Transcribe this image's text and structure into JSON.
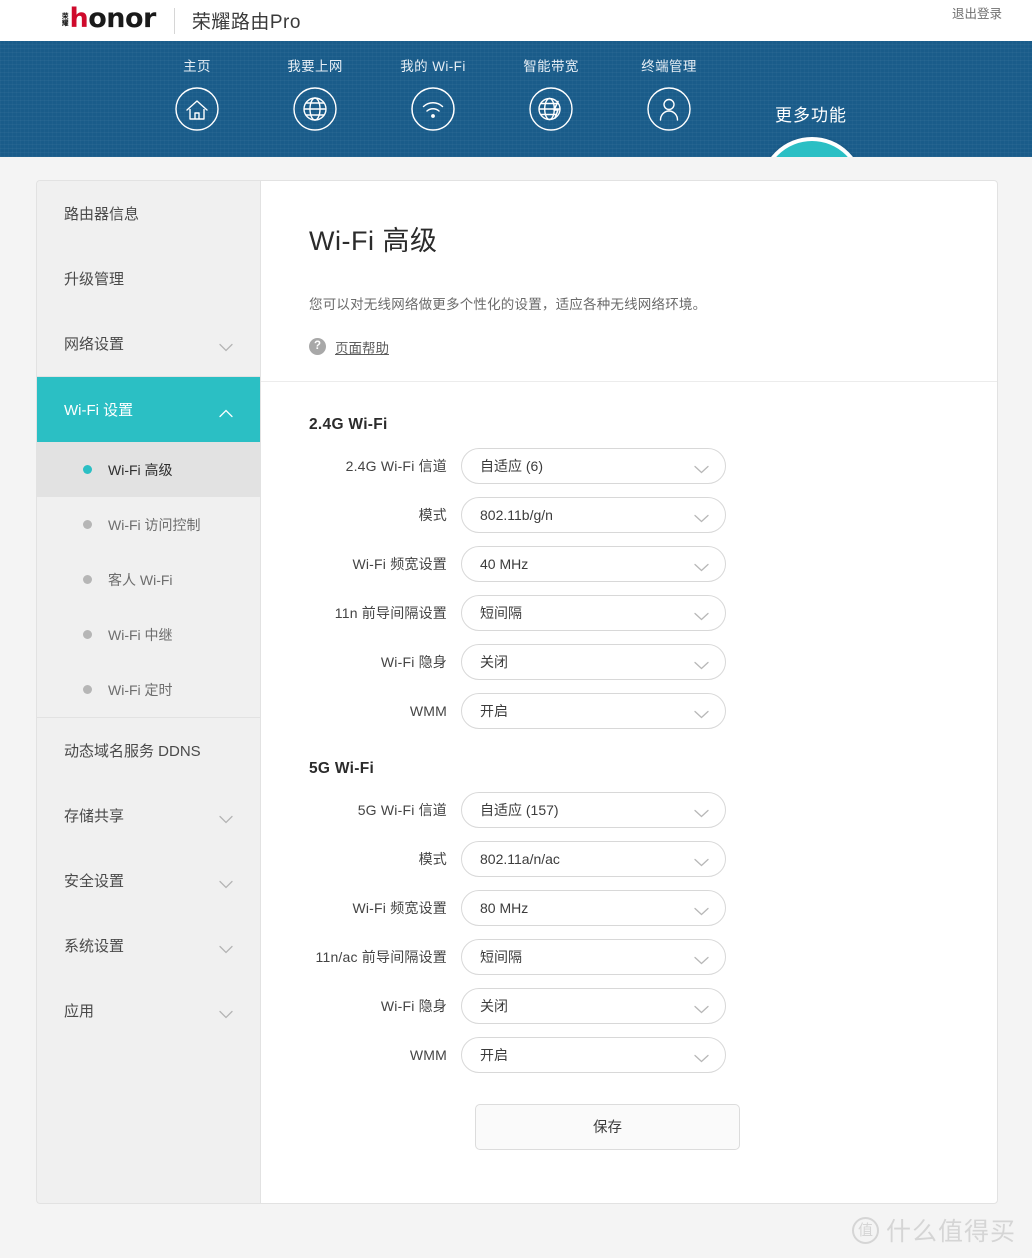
{
  "brand": {
    "logo_cn_top": "荣",
    "logo_cn_bottom": "耀",
    "logo_word_h": "h",
    "logo_word_rest": "onor",
    "product": "荣耀路由Pro",
    "logout": "退出登录"
  },
  "nav": {
    "items": [
      {
        "label": "主页",
        "icon": "home-icon"
      },
      {
        "label": "我要上网",
        "icon": "globe-icon"
      },
      {
        "label": "我的 Wi-Fi",
        "icon": "wifi-icon"
      },
      {
        "label": "智能带宽",
        "icon": "globe-bolt-icon"
      },
      {
        "label": "终端管理",
        "icon": "user-icon"
      }
    ],
    "more_label": "更多功能",
    "more_icon": "hamburger-icon"
  },
  "sidebar": {
    "items": [
      {
        "label": "路由器信息",
        "expandable": false,
        "active": false
      },
      {
        "label": "升级管理",
        "expandable": false,
        "active": false
      },
      {
        "label": "网络设置",
        "expandable": true,
        "active": false
      },
      {
        "label": "Wi-Fi 设置",
        "expandable": true,
        "active": true
      },
      {
        "label": "动态域名服务 DDNS",
        "expandable": false,
        "active": false
      },
      {
        "label": "存储共享",
        "expandable": true,
        "active": false
      },
      {
        "label": "安全设置",
        "expandable": true,
        "active": false
      },
      {
        "label": "系统设置",
        "expandable": true,
        "active": false
      },
      {
        "label": "应用",
        "expandable": true,
        "active": false
      }
    ],
    "sub_items": [
      {
        "label": "Wi-Fi 高级",
        "current": true
      },
      {
        "label": "Wi-Fi 访问控制",
        "current": false
      },
      {
        "label": "客人 Wi-Fi",
        "current": false
      },
      {
        "label": "Wi-Fi 中继",
        "current": false
      },
      {
        "label": "Wi-Fi 定时",
        "current": false
      }
    ]
  },
  "main": {
    "title": "Wi-Fi 高级",
    "description": "您可以对无线网络做更多个性化的设置，适应各种无线网络环境。",
    "help_link": "页面帮助",
    "help_icon_glyph": "?",
    "sections": [
      {
        "title": "2.4G Wi-Fi",
        "fields": [
          {
            "label": "2.4G Wi-Fi 信道",
            "value": "自适应 (6)"
          },
          {
            "label": "模式",
            "value": "802.11b/g/n"
          },
          {
            "label": "Wi-Fi 频宽设置",
            "value": "40 MHz"
          },
          {
            "label": "11n 前导间隔设置",
            "value": "短间隔"
          },
          {
            "label": "Wi-Fi 隐身",
            "value": "关闭"
          },
          {
            "label": "WMM",
            "value": "开启"
          }
        ]
      },
      {
        "title": "5G Wi-Fi",
        "fields": [
          {
            "label": "5G Wi-Fi 信道",
            "value": "自适应 (157)"
          },
          {
            "label": "模式",
            "value": "802.11a/n/ac"
          },
          {
            "label": "Wi-Fi 频宽设置",
            "value": "80 MHz"
          },
          {
            "label": "11n/ac 前导间隔设置",
            "value": "短间隔"
          },
          {
            "label": "Wi-Fi 隐身",
            "value": "关闭"
          },
          {
            "label": "WMM",
            "value": "开启"
          }
        ]
      }
    ],
    "save_label": "保存"
  },
  "watermark": {
    "mark": "值",
    "text": "什么值得买"
  },
  "colors": {
    "navbar": "#1a5c8a",
    "accent_teal": "#2bbfc4",
    "brand_red": "#cf0a2c",
    "page_bg": "#f4f4f4",
    "sidebar_bg": "#f0f0f0"
  }
}
